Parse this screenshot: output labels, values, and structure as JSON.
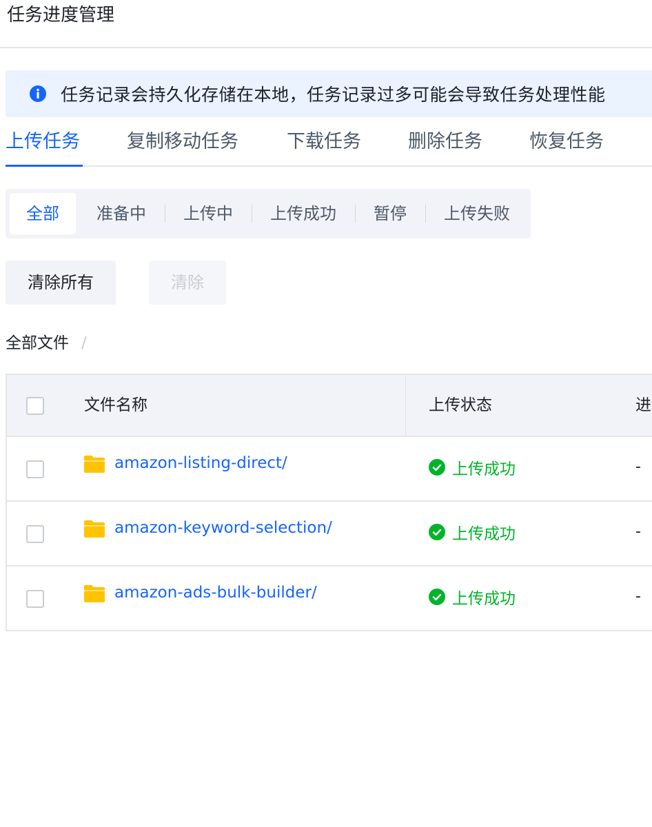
{
  "page": {
    "title": "任务进度管理"
  },
  "notice": {
    "text": "任务记录会持久化存储在本地，任务记录过多可能会导致任务处理性能",
    "icon": "info-icon"
  },
  "tabs": [
    {
      "label": "上传任务",
      "active": true
    },
    {
      "label": "复制移动任务"
    },
    {
      "label": "下载任务"
    },
    {
      "label": "删除任务"
    },
    {
      "label": "恢复任务"
    }
  ],
  "filters": [
    {
      "label": "全部",
      "active": true
    },
    {
      "label": "准备中"
    },
    {
      "label": "上传中"
    },
    {
      "label": "上传成功"
    },
    {
      "label": "暂停"
    },
    {
      "label": "上传失败"
    }
  ],
  "actions": {
    "clear_all": "清除所有",
    "clear": "清除"
  },
  "breadcrumb": {
    "root": "全部文件",
    "sep": "/"
  },
  "table": {
    "columns": [
      "文件名称",
      "上传状态",
      "进度"
    ],
    "rows": [
      {
        "name": "amazon-listing-direct/",
        "status": "上传成功",
        "progress": "-"
      },
      {
        "name": "amazon-keyword-selection/",
        "status": "上传成功",
        "progress": "-"
      },
      {
        "name": "amazon-ads-bulk-builder/",
        "status": "上传成功",
        "progress": "-"
      }
    ]
  },
  "colors": {
    "accent": "#1664ff",
    "success": "#00b42a",
    "folder": "#ffc300",
    "notice_bg": "#eaf3ff"
  }
}
